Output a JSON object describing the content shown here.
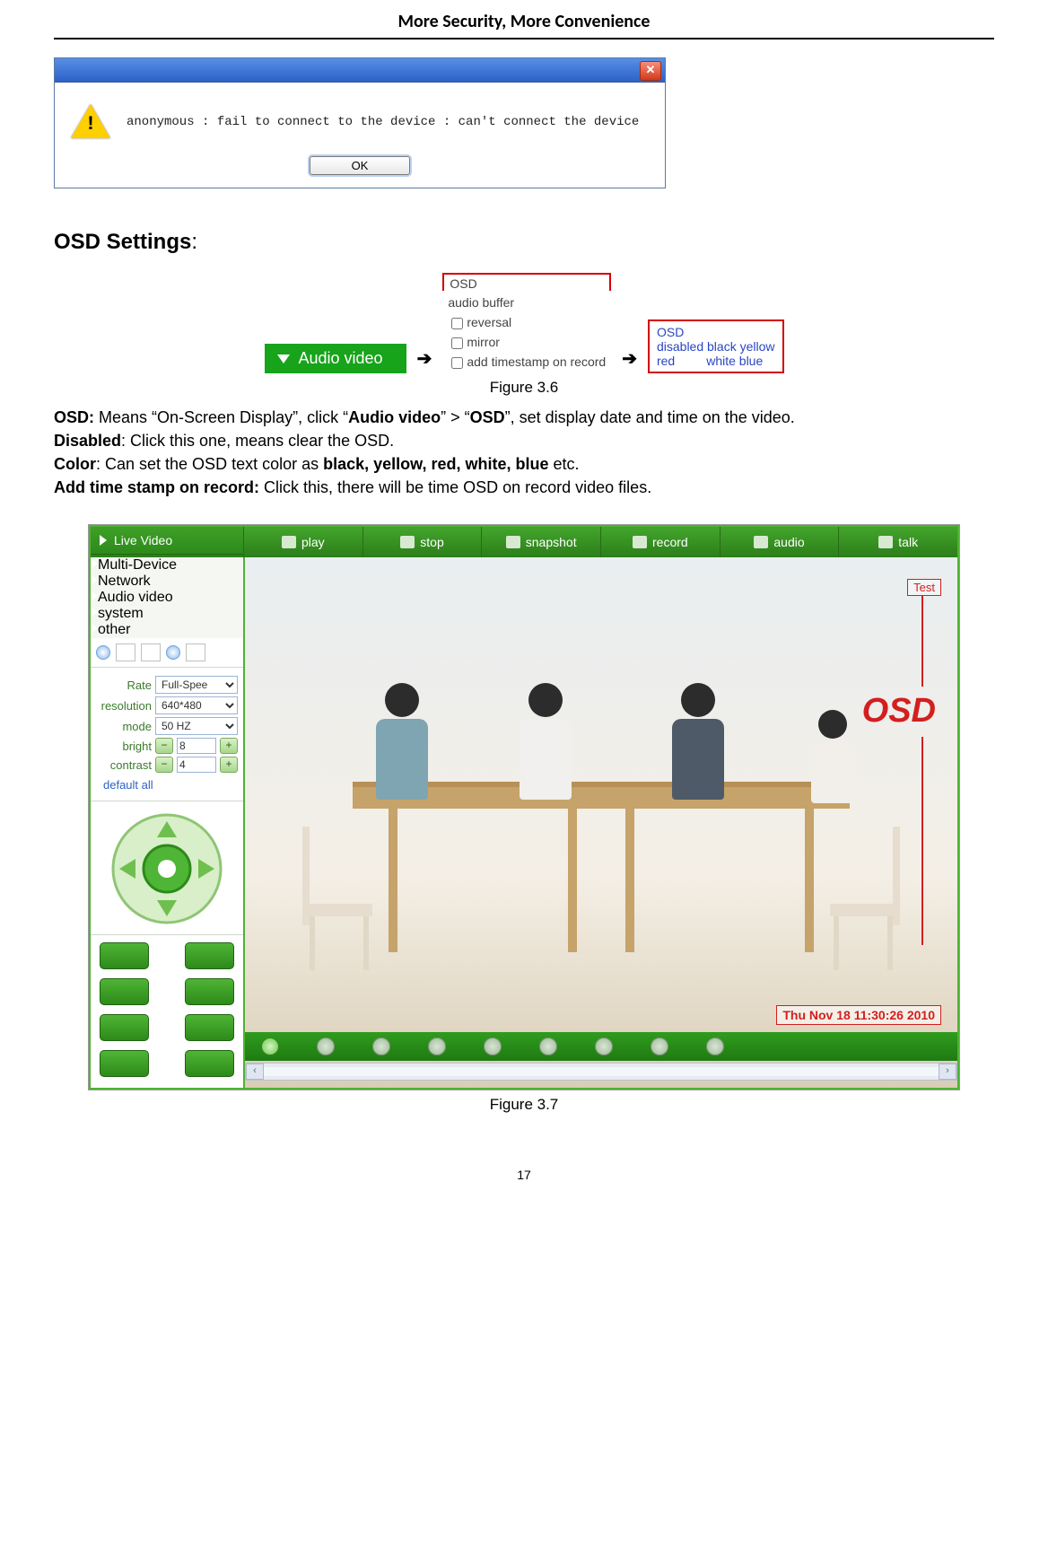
{
  "header": {
    "title": "More Security, More Convenience"
  },
  "dialog": {
    "message": "anonymous : fail to connect to the device : can't connect the device",
    "ok": "OK"
  },
  "section_heading": "OSD Settings",
  "fig36": {
    "audio_video_btn": "Audio video",
    "menu_osd": "OSD",
    "menu_audio_buffer": "audio buffer",
    "menu_reversal": "reversal",
    "menu_mirror": "mirror",
    "menu_timestamp": "add timestamp on record",
    "osd_popup_line1": "OSD",
    "osd_popup_line2": "disabled black yellow",
    "osd_popup_line3": "red         white blue",
    "caption": "Figure 3.6"
  },
  "paras": {
    "p1a": "OSD:",
    "p1b": " Means “On-Screen Display”, click “",
    "p1c": "Audio video",
    "p1d": "” > “",
    "p1e": "OSD",
    "p1f": "”, set display date and time on the video.",
    "p2a": "Disabled",
    "p2b": ": Click this one, means clear the OSD.",
    "p3a": "Color",
    "p3b": ": Can set the OSD text color as ",
    "p3c": "black, yellow, red, white, blue",
    "p3d": " etc.",
    "p4a": "Add time stamp on record:",
    "p4b": " Click this, there will be time OSD on record video files."
  },
  "app": {
    "toolbar": {
      "play": "play",
      "stop": "stop",
      "snapshot": "snapshot",
      "record": "record",
      "audio": "audio",
      "talk": "talk"
    },
    "sidebar": [
      "Live Video",
      "Multi-Device",
      "Network",
      "Audio video",
      "system",
      "other"
    ],
    "params": {
      "rate_label": "Rate",
      "rate_value": "Full-Spee",
      "resolution_label": "resolution",
      "resolution_value": "640*480",
      "mode_label": "mode",
      "mode_value": "50 HZ",
      "bright_label": "bright",
      "bright_value": "8",
      "contrast_label": "contrast",
      "contrast_value": "4",
      "default_all": "default all"
    },
    "osd": {
      "label": "OSD",
      "test": "Test",
      "timestamp": "Thu Nov 18 11:30:26 2010"
    }
  },
  "fig37_caption": "Figure 3.7",
  "page_number": "17"
}
